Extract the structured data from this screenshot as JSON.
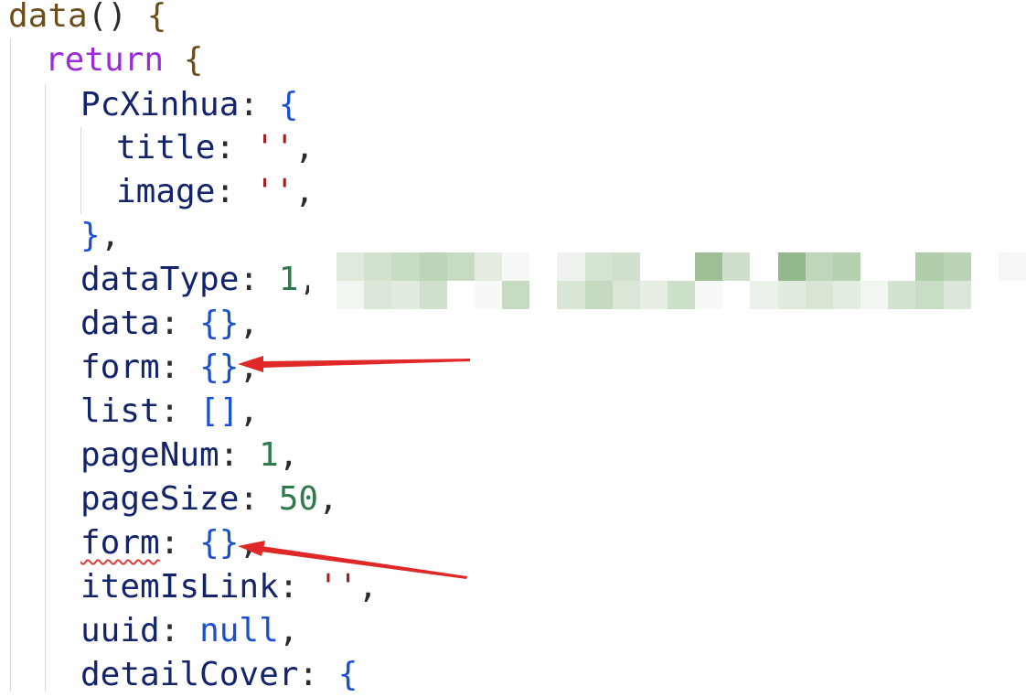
{
  "code": {
    "fn_name": "data",
    "fn_parens": "()",
    "open_brace": "{",
    "return_kw": "return",
    "props": {
      "pcxinhua": "PcXinhua",
      "title": "title",
      "image": "image",
      "dataType": "dataType",
      "data": "data",
      "form": "form",
      "list": "list",
      "pageNum": "pageNum",
      "pageSize": "pageSize",
      "itemIsLink": "itemIsLink",
      "uuid": "uuid",
      "detailCover": "detailCover"
    },
    "values": {
      "empty_string": "''",
      "dataType": "1",
      "pageNum": "1",
      "pageSize": "50",
      "null": "null",
      "empty_object": "{}",
      "empty_array": "[]"
    },
    "blurred_comment_lead": "/"
  },
  "colors": {
    "keyword": "#9a2bd6",
    "property": "#14246b",
    "string": "#a02020",
    "number": "#2e7a4a",
    "bracket": "#1a4fd1",
    "annotation_arrow": "#e02828",
    "warning_squiggle": "#e23b3b"
  },
  "annotations": [
    {
      "target": "form",
      "type": "arrow"
    },
    {
      "target": "form (duplicate)",
      "type": "arrow"
    }
  ]
}
